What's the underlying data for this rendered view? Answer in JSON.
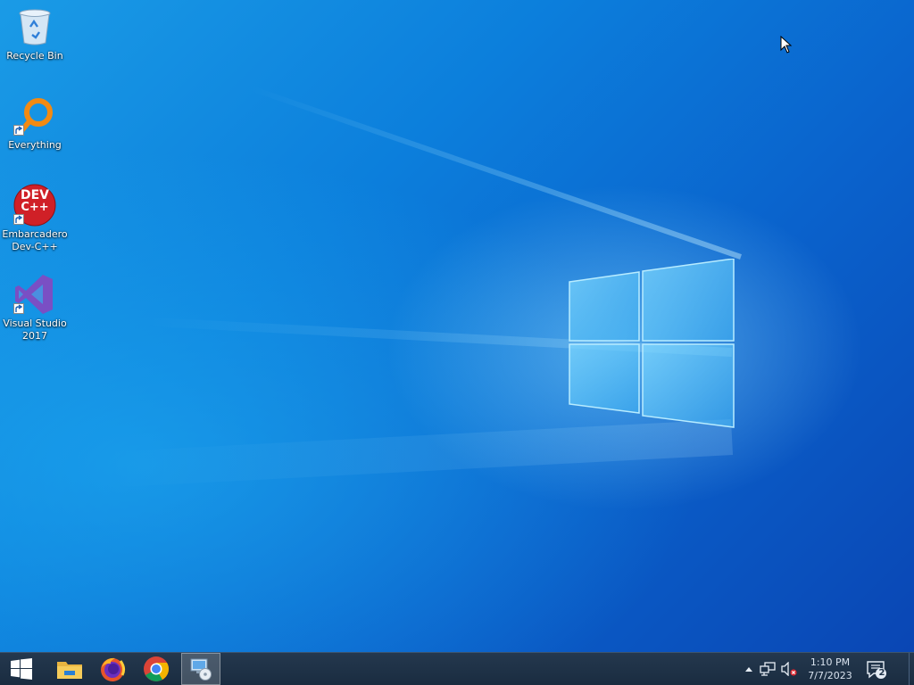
{
  "desktop": {
    "icons": [
      {
        "label": "Recycle Bin",
        "icon": "recycle-bin-icon",
        "shortcut": false
      },
      {
        "label": "Everything",
        "icon": "everything-search-icon",
        "shortcut": true
      },
      {
        "label": "Embarcadero Dev-C++",
        "icon": "devcpp-icon",
        "shortcut": true,
        "icon_text_top": "DEV",
        "icon_text_bottom": "C++"
      },
      {
        "label": "Visual Studio 2017",
        "icon": "visual-studio-icon",
        "shortcut": true
      }
    ]
  },
  "taskbar": {
    "start": {
      "icon": "windows-start-icon"
    },
    "pinned": [
      {
        "name": "File Explorer",
        "icon": "file-explorer-icon",
        "active": false
      },
      {
        "name": "Firefox",
        "icon": "firefox-icon",
        "active": false
      },
      {
        "name": "Google Chrome",
        "icon": "chrome-icon",
        "active": false
      },
      {
        "name": "Remote Desktop",
        "icon": "remote-desktop-icon",
        "active": true
      }
    ],
    "tray": {
      "icons": [
        "chevron-up-icon",
        "network-icon",
        "volume-muted-icon"
      ],
      "time": "1:10 PM",
      "date": "7/7/2023",
      "notification_count": "2"
    }
  },
  "colors": {
    "wallpaper_accent": "#0a62cc",
    "taskbar": "#1c3046",
    "clock_text": "#d8e2ee"
  }
}
